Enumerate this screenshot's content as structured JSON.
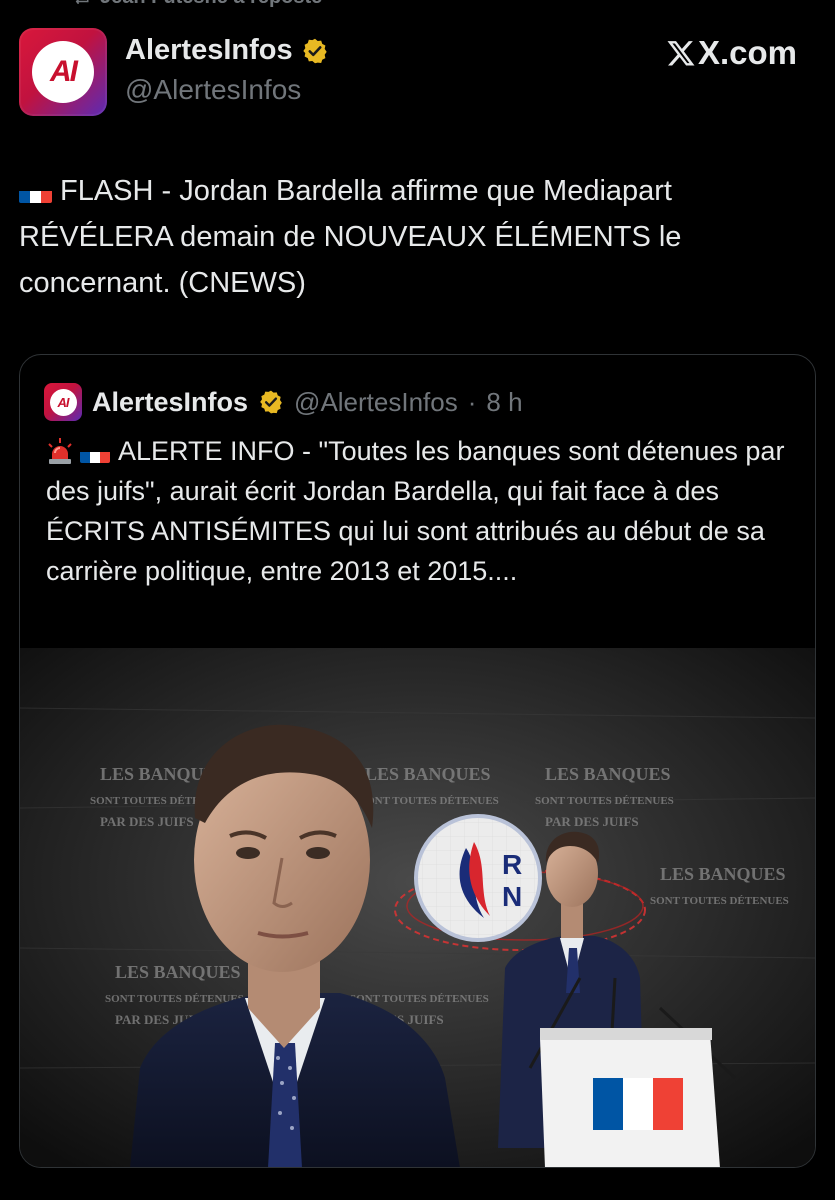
{
  "repost": {
    "text": "Jean Futesne a reposté"
  },
  "author": {
    "avatar_text": "AI",
    "name": "AlertesInfos",
    "handle": "@AlertesInfos",
    "verified": true
  },
  "source_badge": {
    "label": "X.com",
    "icon": "x-logo-icon"
  },
  "tweet": {
    "flag_icon": "france-flag-icon",
    "text": "FLASH - Jordan Bardella affirme que Mediapart RÉVÉLERA demain de NOUVEAUX ÉLÉMENTS le concernant. (CNEWS)"
  },
  "quoted": {
    "avatar_text": "AI",
    "name": "AlertesInfos",
    "handle": "@AlertesInfos",
    "separator": "·",
    "time": "8 h",
    "icons": [
      "siren-icon",
      "france-flag-icon"
    ],
    "text": "ALERTE INFO - \"Toutes les banques sont détenues par des juifs\", aurait écrit Jordan Bardella, qui fait face à des ÉCRITS ANTISÉMITES qui lui sont attribués au début de sa carrière politique, entre 2013 et 2015....",
    "image": {
      "wall_texts": [
        "LES BANQUES",
        "SONT TOUTES DÉTENUES",
        "PAR DES JUIFS"
      ],
      "logo_letters": [
        "R",
        "N"
      ]
    }
  },
  "colors": {
    "background": "#000000",
    "text_primary": "#e7e9ea",
    "text_secondary": "#71767b",
    "border": "#2f3336",
    "verified_gold": "#e8b923",
    "brand_red": "#c8102e",
    "flag_blue": "#0055a4",
    "flag_red": "#ef4135"
  }
}
